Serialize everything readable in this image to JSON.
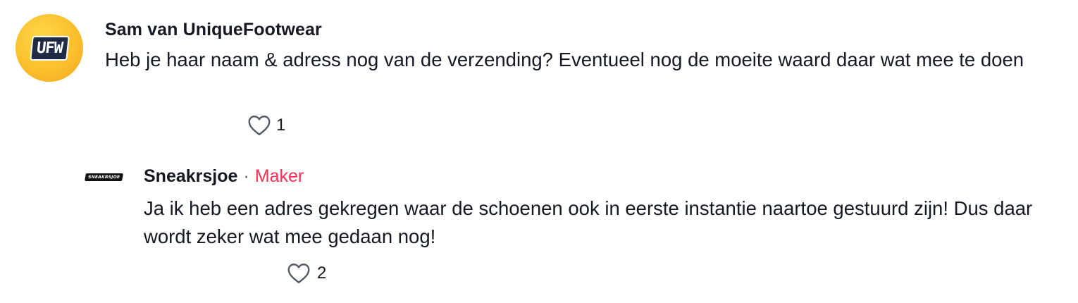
{
  "comments": [
    {
      "avatar_text": "UFW",
      "author": "Sam van UniqueFootwear",
      "text": "Heb je haar naam & adress nog van de verzending? Eventueel nog de moeite waard daar wat mee te doen",
      "likes": "1",
      "like_icon": "heart-outline-icon"
    }
  ],
  "reply": {
    "avatar_text": "SNEAKRSJOE",
    "author": "Sneakrsjoe",
    "separator": "·",
    "badge": "Maker",
    "text": "Ja ik heb een adres gekregen waar de schoenen ook in eerste instantie naartoe gestuurd zijn! Dus daar wordt zeker wat mee gedaan nog!",
    "likes": "2",
    "like_icon": "heart-outline-icon"
  },
  "colors": {
    "text": "#161823",
    "badge": "#fe2c55",
    "avatar_bg": "#fbbf2c"
  }
}
